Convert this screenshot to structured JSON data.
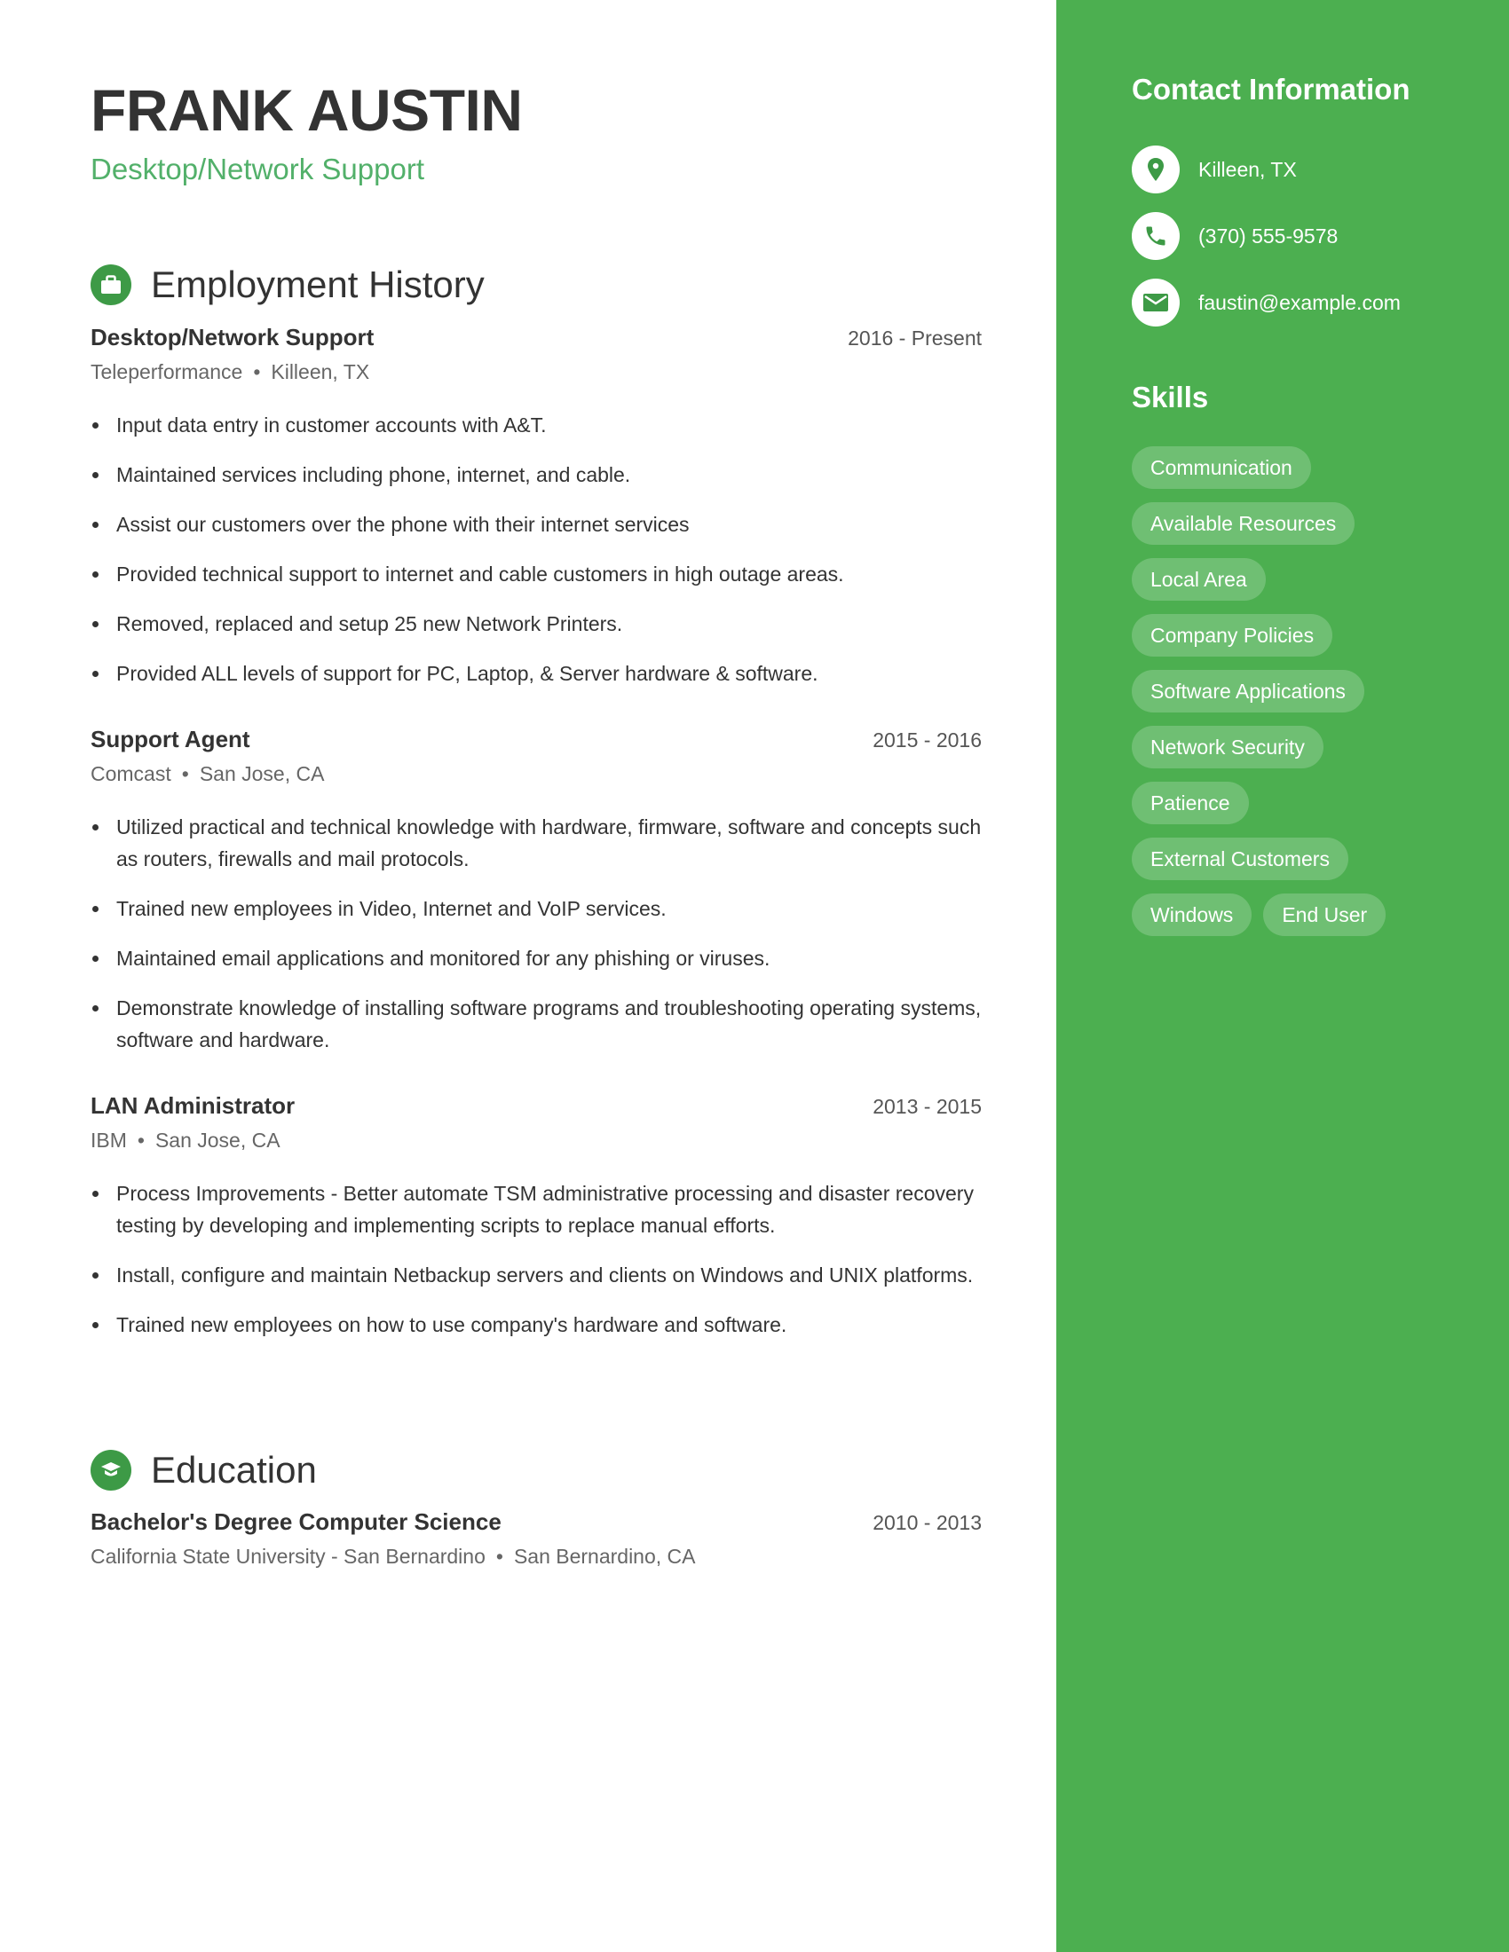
{
  "header": {
    "name": "FRANK AUSTIN",
    "title": "Desktop/Network Support"
  },
  "colors": {
    "accent": "#4caf50",
    "accent_dark": "#3d9a46",
    "title_green": "#52b06a",
    "text": "#333333"
  },
  "employment": {
    "heading": "Employment History",
    "icon": "briefcase-icon",
    "jobs": [
      {
        "title": "Desktop/Network Support",
        "dates": "2016 - Present",
        "company": "Teleperformance",
        "separator": "•",
        "location": "Killeen, TX",
        "bullets": [
          "Input data entry in customer accounts with A&T.",
          "Maintained services including phone, internet, and cable.",
          "Assist our customers over the phone with their internet services",
          "Provided technical support to internet and cable customers in high outage areas.",
          "Removed, replaced and setup 25 new Network Printers.",
          "Provided ALL levels of support for PC, Laptop, & Server hardware & software."
        ]
      },
      {
        "title": "Support Agent",
        "dates": "2015 - 2016",
        "company": "Comcast",
        "separator": "•",
        "location": "San Jose, CA",
        "bullets": [
          "Utilized practical and technical knowledge with hardware, firmware, software and concepts such as routers, firewalls and mail protocols.",
          "Trained new employees in Video, Internet and VoIP services.",
          "Maintained email applications and monitored for any phishing or viruses.",
          "Demonstrate knowledge of installing software programs and troubleshooting operating systems, software and hardware."
        ]
      },
      {
        "title": "LAN Administrator",
        "dates": "2013 - 2015",
        "company": "IBM",
        "separator": "•",
        "location": "San Jose, CA",
        "bullets": [
          "Process Improvements - Better automate TSM administrative processing and disaster recovery testing by developing and implementing scripts to replace manual efforts.",
          "Install, configure and maintain Netbackup servers and clients on Windows and UNIX platforms.",
          "Trained new employees on how to use company's hardware and software."
        ]
      }
    ]
  },
  "education": {
    "heading": "Education",
    "icon": "graduation-cap-icon",
    "entries": [
      {
        "degree": "Bachelor's Degree Computer Science",
        "dates": "2010 - 2013",
        "school": "California State University - San Bernardino",
        "separator": "•",
        "location": "San Bernardino, CA"
      }
    ]
  },
  "sidebar": {
    "contact_heading": "Contact Information",
    "contacts": [
      {
        "icon": "location-pin-icon",
        "text": "Killeen, TX"
      },
      {
        "icon": "phone-icon",
        "text": "(370) 555-9578"
      },
      {
        "icon": "envelope-icon",
        "text": "faustin@example.com"
      }
    ],
    "skills_heading": "Skills",
    "skills": [
      "Communication",
      "Available Resources",
      "Local Area",
      "Company Policies",
      "Software Applications",
      "Network Security",
      "Patience",
      "External Customers",
      "Windows",
      "End User"
    ]
  }
}
